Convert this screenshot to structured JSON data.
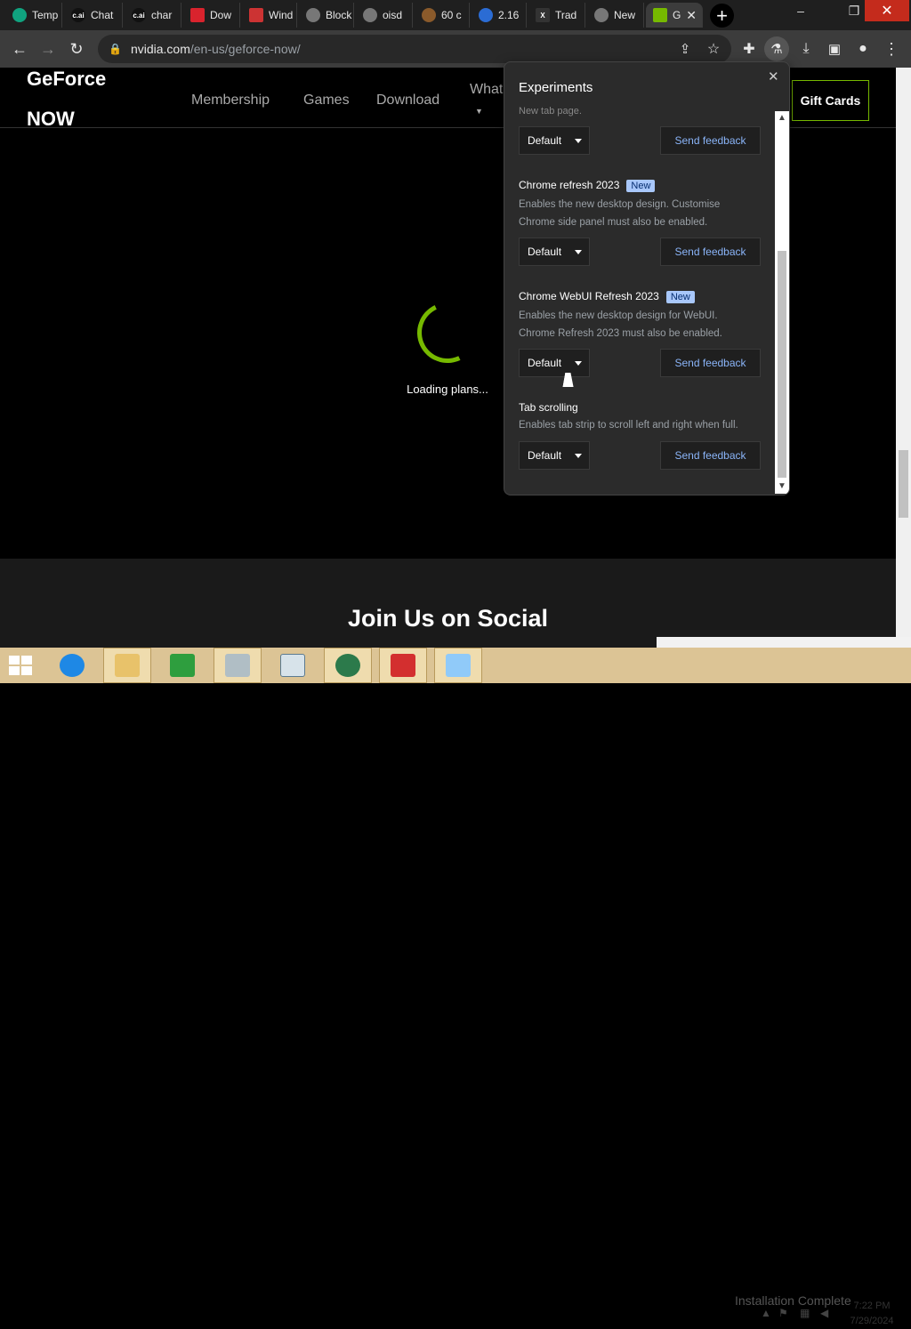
{
  "browser": {
    "tabs": [
      {
        "label": "Temp",
        "icon": "chatgpt-icon",
        "color": "#10a37f"
      },
      {
        "label": "Chat",
        "icon": "characterai-icon",
        "color": "#111111",
        "mark": "c.ai"
      },
      {
        "label": "char",
        "icon": "characterai-icon",
        "color": "#111111",
        "mark": "c.ai"
      },
      {
        "label": "Dow",
        "icon": "download-site-icon",
        "color": "#d9232d"
      },
      {
        "label": "Wind",
        "icon": "windows-site-icon",
        "color": "#cc3333"
      },
      {
        "label": "Block",
        "icon": "globe-icon",
        "color": "#777777"
      },
      {
        "label": "oisd",
        "icon": "globe-icon",
        "color": "#777777"
      },
      {
        "label": "60 c",
        "icon": "cookie-icon",
        "color": "#8a5a2b"
      },
      {
        "label": "2.16",
        "icon": "cloud-icon",
        "color": "#2b6cd4"
      },
      {
        "label": "Trad",
        "icon": "tradingview-icon",
        "color": "#333333",
        "mark": "X"
      },
      {
        "label": "New",
        "icon": "chrome-icon",
        "color": "#777777"
      },
      {
        "label": "G",
        "icon": "nvidia-icon",
        "color": "#76b900"
      }
    ],
    "window_controls": {
      "minimize": "–",
      "restore": "❐",
      "close": "✕"
    },
    "url_host": "nvidia.com",
    "url_path": "/en-us/geforce-now/"
  },
  "page": {
    "logo_line1": "GeForce",
    "logo_line2": "NOW",
    "nav": [
      "Membership",
      "Games",
      "Download",
      "What"
    ],
    "gift_cards": "Gift Cards",
    "loading": "Loading plans...",
    "social_heading": "Join Us on Social",
    "accent": "#76b900"
  },
  "experiments": {
    "title": "Experiments",
    "cut_text": "New tab page.",
    "default_label": "Default",
    "feedback_label": "Send feedback",
    "new_badge": "New",
    "items": [
      {
        "name": "Chrome refresh 2023",
        "badge": true,
        "desc1": "Enables the new desktop design. Customise",
        "desc2": "Chrome side panel must also be enabled."
      },
      {
        "name": "Chrome WebUI Refresh 2023",
        "badge": true,
        "desc1": "Enables the new desktop design for WebUI.",
        "desc2": "Chrome Refresh 2023 must also be enabled."
      },
      {
        "name": "Tab scrolling",
        "badge": false,
        "desc1": "Enables tab strip to scroll left and right when full.",
        "desc2": ""
      }
    ]
  },
  "taskbar": {
    "notification": "Installation Complete",
    "time": "7:22 PM",
    "date": "7/29/2024"
  }
}
